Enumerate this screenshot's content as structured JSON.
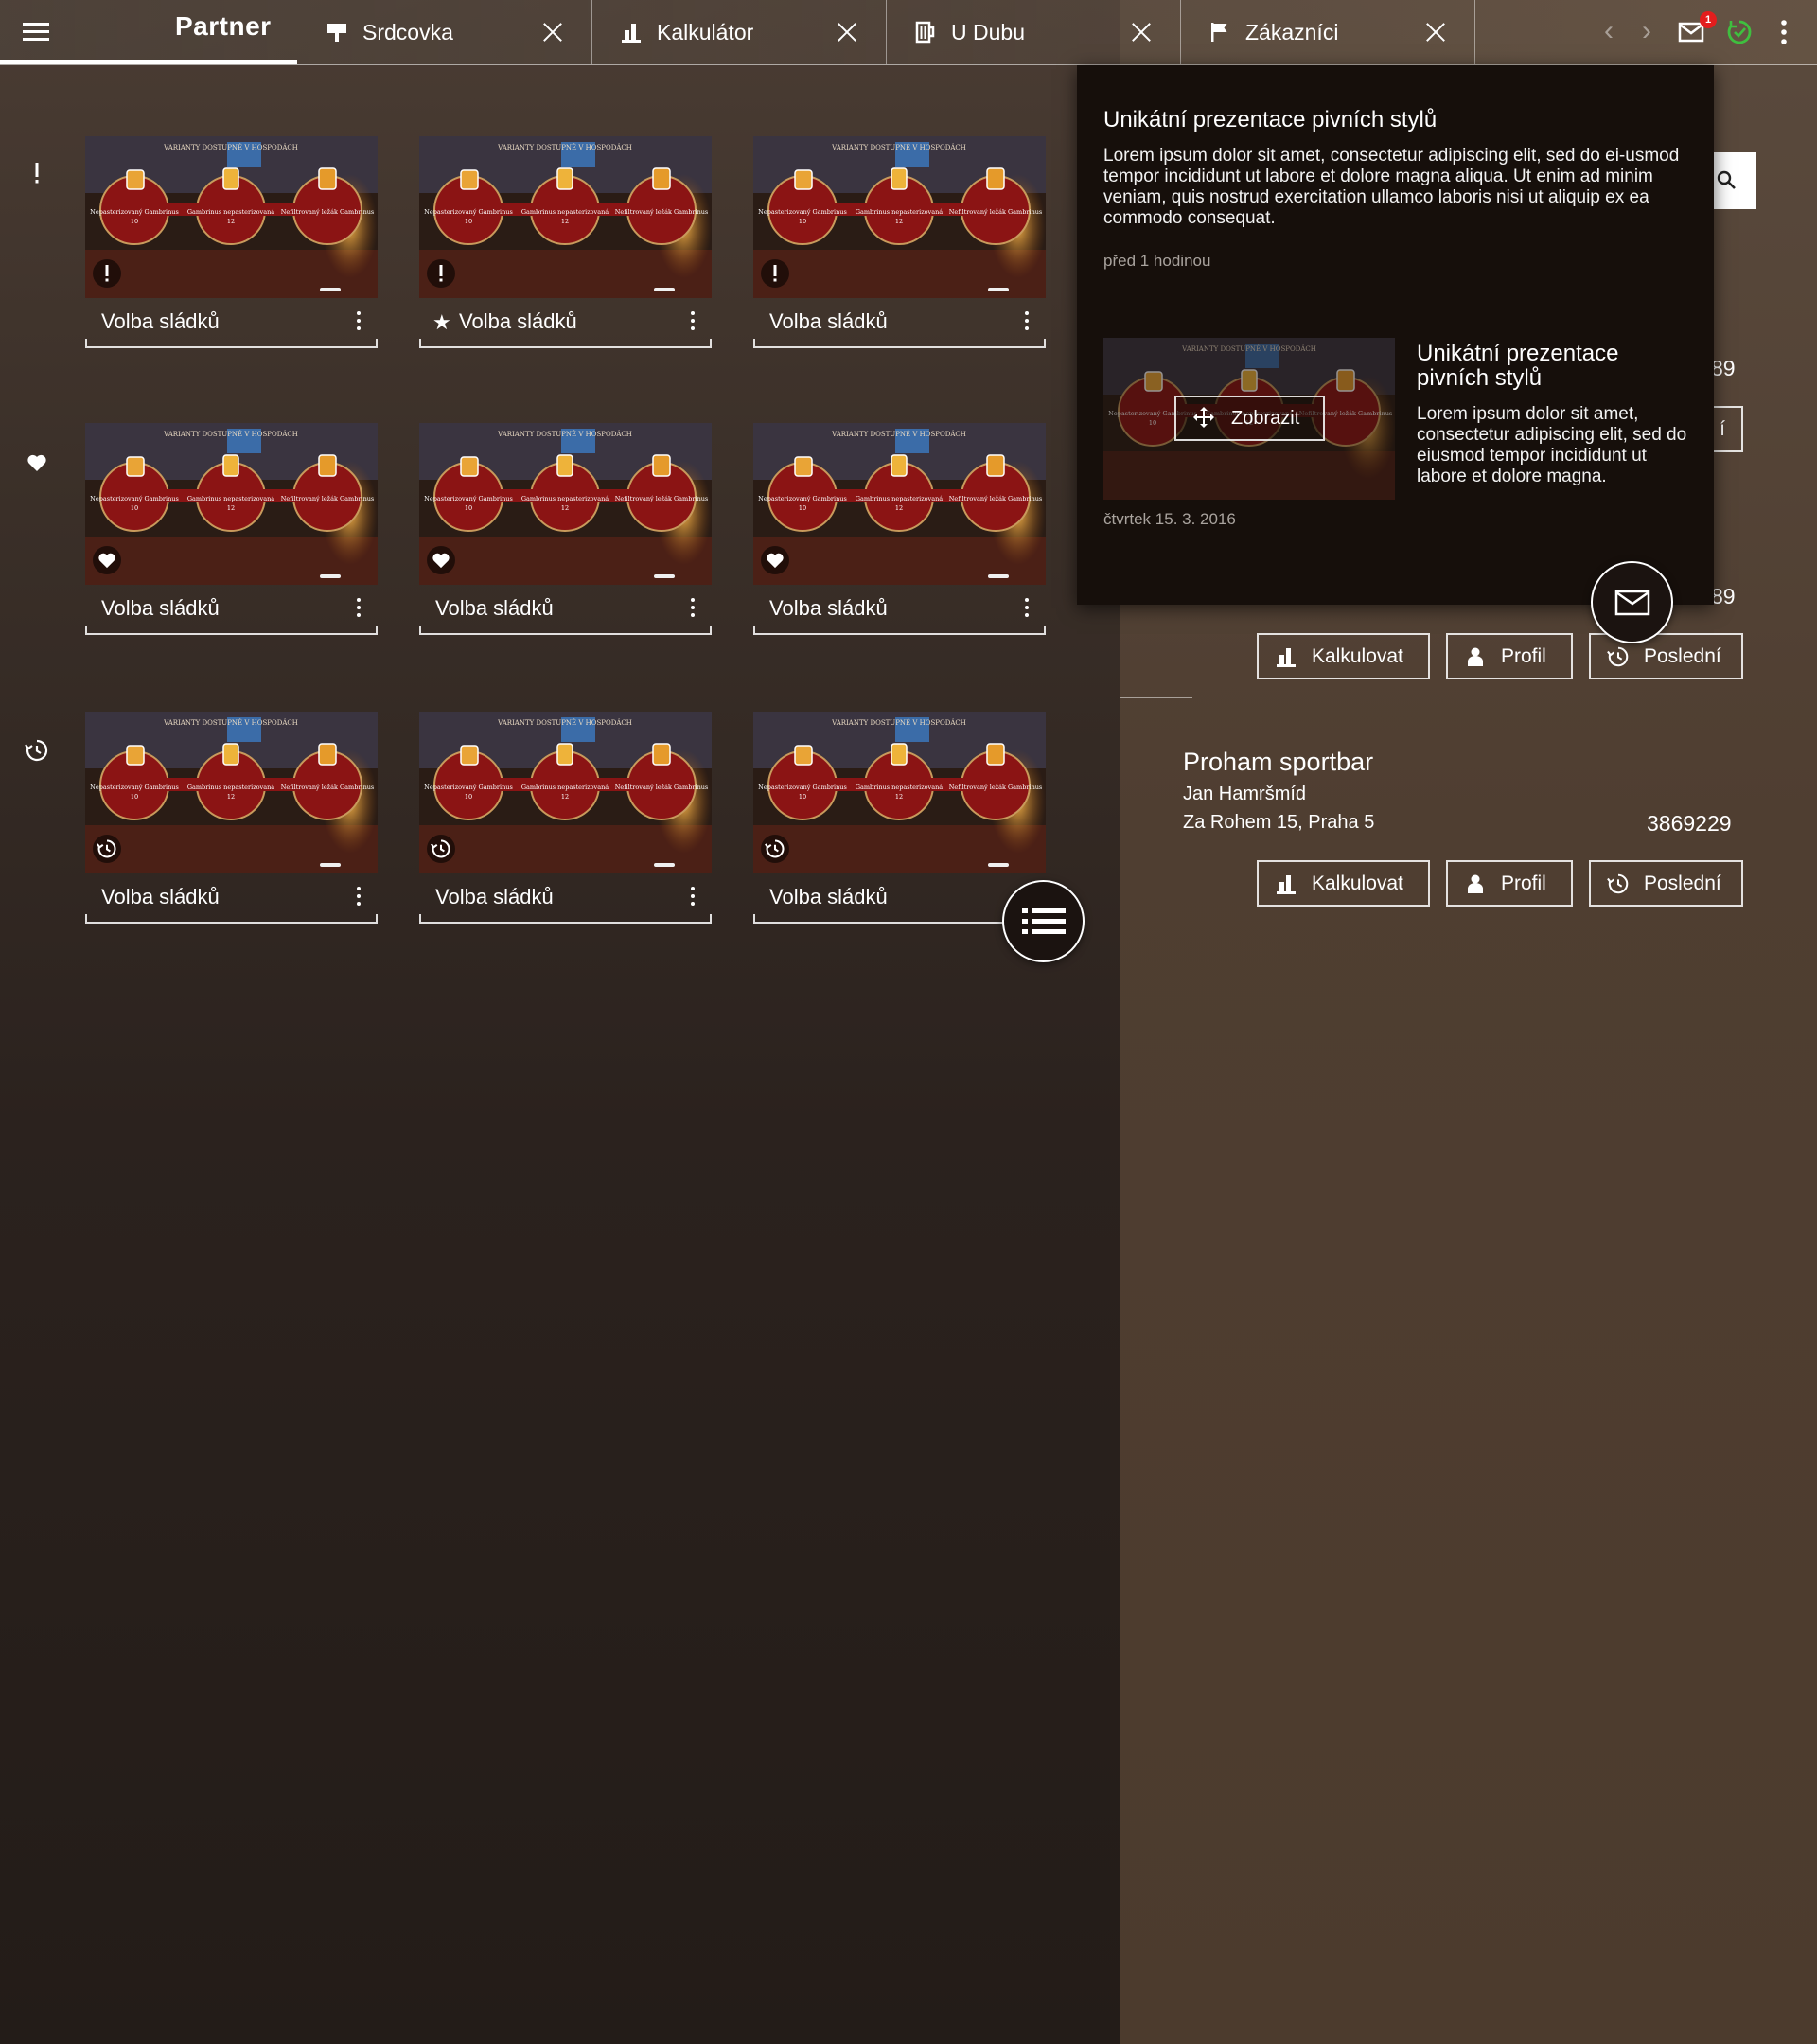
{
  "app": {
    "brand": "Partner",
    "tabs": [
      {
        "label": "Srdcovka",
        "icon": "pub-sign-icon"
      },
      {
        "label": "Kalkulátor",
        "icon": "bar-chart-icon"
      },
      {
        "label": "U Dubu",
        "icon": "beer-mug-icon"
      },
      {
        "label": "Zákazníci",
        "icon": "flag-icon"
      }
    ],
    "mail_badge": "1"
  },
  "sections": [
    {
      "icon": "exclamation-icon"
    },
    {
      "icon": "heart-icon"
    },
    {
      "icon": "history-icon"
    }
  ],
  "cards": [
    {
      "title": "Volba sládků",
      "badge": "exclamation"
    },
    {
      "title": "Volba sládků",
      "badge": "exclamation",
      "starred": true
    },
    {
      "title": "Volba sládků",
      "badge": "exclamation"
    },
    {
      "title": "Volba sládků",
      "badge": "heart"
    },
    {
      "title": "Volba sládků",
      "badge": "heart"
    },
    {
      "title": "Volba sládků",
      "badge": "heart"
    },
    {
      "title": "Volba sládků",
      "badge": "history"
    },
    {
      "title": "Volba sládků",
      "badge": "history"
    },
    {
      "title": "Volba sládků",
      "badge": "history"
    }
  ],
  "thumbnail": {
    "header": "VARIANTY DOSTUPNÉ V HOSPODÁCH",
    "beers": [
      {
        "name": "Nepasterizovaný Gambrinus",
        "num": "10"
      },
      {
        "name": "Gambrinus nepasterizovaná",
        "num": "12"
      },
      {
        "name": "Nefiltrovaný ležák Gambrinus",
        "num": ""
      }
    ]
  },
  "customers": {
    "partial_number_1": "89",
    "partial_button": "í",
    "partial_number_2": "89",
    "entry": {
      "name": "Proham sportbar",
      "contact": "Jan Hamršmíd",
      "address": "Za Rohem 15, Praha 5",
      "number": "3869229"
    },
    "buttons": {
      "calc": "Kalkulovat",
      "profile": "Profil",
      "last": "Poslední"
    }
  },
  "notifications": {
    "first": {
      "title": "Unikátní prezentace pivních stylů",
      "text": "Lorem ipsum dolor sit amet, consectetur adipiscing elit, sed do ei-usmod tempor incididunt ut labore et dolore magna aliqua. Ut enim ad minim veniam, quis nostrud exercitation ullamco laboris nisi ut aliquip ex ea commodo consequat.",
      "time": "před 1 hodinou"
    },
    "second": {
      "title": "Unikátní prezentace pivních stylů",
      "text": "Lorem ipsum dolor sit amet, consectetur adipiscing elit, sed do eiusmod tempor incididunt ut labore et dolore magna.",
      "time": "čtvrtek 15. 3. 2016",
      "button": "Zobrazit"
    }
  },
  "colors": {
    "badge": "#e31d1d",
    "sync_ok": "#3fbf3f",
    "popup_bg": "#160f0b"
  }
}
